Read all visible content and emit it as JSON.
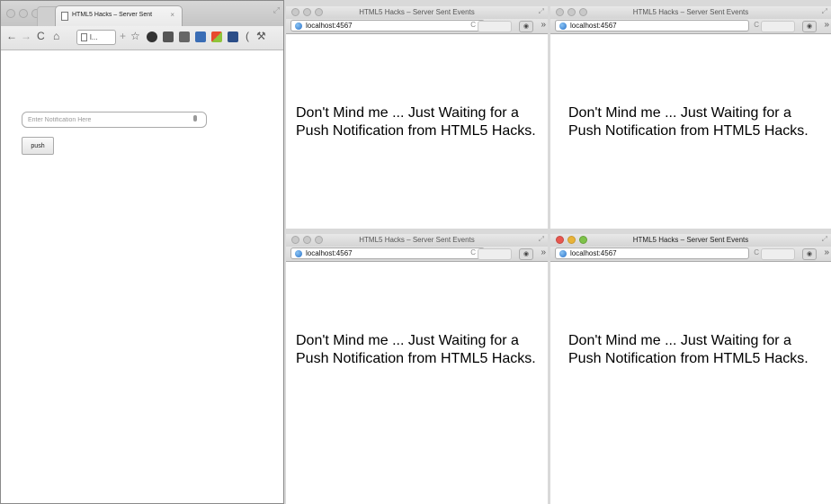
{
  "main_window": {
    "tab_title": "HTML5 Hacks – Server Sent",
    "tab_close": "×",
    "url_text": "l...",
    "input_placeholder": "Enter Notification Here",
    "push_label": "push"
  },
  "small_windows": [
    {
      "id": "top-left",
      "title": "HTML5 Hacks – Server Sent Events",
      "url": "localhost:4567",
      "message": "Don't Mind me ... Just Waiting for a Push Notification from HTML5 Hacks."
    },
    {
      "id": "top-right",
      "title": "HTML5 Hacks – Server Sent Events",
      "url": "localhost:4567",
      "message": "Don't Mind me ... Just Waiting for a Push Notification from HTML5 Hacks."
    },
    {
      "id": "bottom-left",
      "title": "HTML5 Hacks – Server Sent Events",
      "url": "localhost:4567",
      "message": "Don't Mind me ... Just Waiting for a Push Notification from HTML5 Hacks."
    },
    {
      "id": "bottom-right",
      "title": "HTML5 Hacks – Server Sent Events",
      "url": "localhost:4567",
      "message": "Don't Mind me ... Just Waiting for a Push Notification from HTML5 Hacks."
    }
  ],
  "icons": {
    "back": "back-arrow-icon",
    "forward": "forward-arrow-icon",
    "reload": "reload-icon",
    "home": "home-icon",
    "star": "bookmark-star-icon",
    "globe": "globe-icon",
    "stop": "stop-icon",
    "overflow": "overflow-chevron-icon"
  }
}
